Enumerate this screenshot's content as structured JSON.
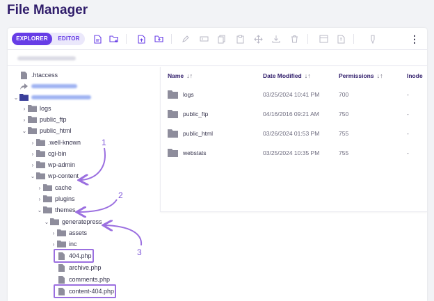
{
  "page": {
    "title": "File Manager"
  },
  "toolbar": {
    "tabs": [
      {
        "label": "EXPLORER",
        "active": true
      },
      {
        "label": "EDITOR",
        "active": false
      }
    ],
    "accent_color": "#673de6",
    "kebab_glyph": "⋮"
  },
  "tree": {
    "items": [
      {
        "label": ".htaccess",
        "type": "file"
      },
      {
        "label": "",
        "type": "symlink"
      },
      {
        "label": "",
        "type": "folder-root"
      },
      {
        "label": "logs",
        "type": "folder"
      },
      {
        "label": "public_ftp",
        "type": "folder"
      },
      {
        "label": "public_html",
        "type": "folder"
      },
      {
        "label": ".well-known",
        "type": "folder"
      },
      {
        "label": "cgi-bin",
        "type": "folder"
      },
      {
        "label": "wp-admin",
        "type": "folder"
      },
      {
        "label": "wp-content",
        "type": "folder"
      },
      {
        "label": "cache",
        "type": "folder"
      },
      {
        "label": "plugins",
        "type": "folder"
      },
      {
        "label": "themes",
        "type": "folder"
      },
      {
        "label": "generatepress",
        "type": "folder"
      },
      {
        "label": "assets",
        "type": "folder"
      },
      {
        "label": "inc",
        "type": "folder"
      },
      {
        "label": "404.php",
        "type": "file"
      },
      {
        "label": "archive.php",
        "type": "file"
      },
      {
        "label": "comments.php",
        "type": "file"
      },
      {
        "label": "content-404.php",
        "type": "file"
      }
    ]
  },
  "list": {
    "headers": {
      "name": "Name",
      "date": "Date Modified",
      "permissions": "Permissions",
      "inode": "Inode"
    },
    "sort_glyph": "↓↑",
    "rows": [
      {
        "name": "logs",
        "date": "03/25/2024 10:41 PM",
        "permissions": "700",
        "inode": "-"
      },
      {
        "name": "public_ftp",
        "date": "04/16/2016 09:21 AM",
        "permissions": "750",
        "inode": "-"
      },
      {
        "name": "public_html",
        "date": "03/26/2024 01:53 PM",
        "permissions": "755",
        "inode": "-"
      },
      {
        "name": "webstats",
        "date": "03/25/2024 10:35 PM",
        "permissions": "755",
        "inode": "-"
      }
    ]
  },
  "annotations": {
    "one": "1",
    "two": "2",
    "three": "3",
    "color": "#9b6fe0"
  }
}
